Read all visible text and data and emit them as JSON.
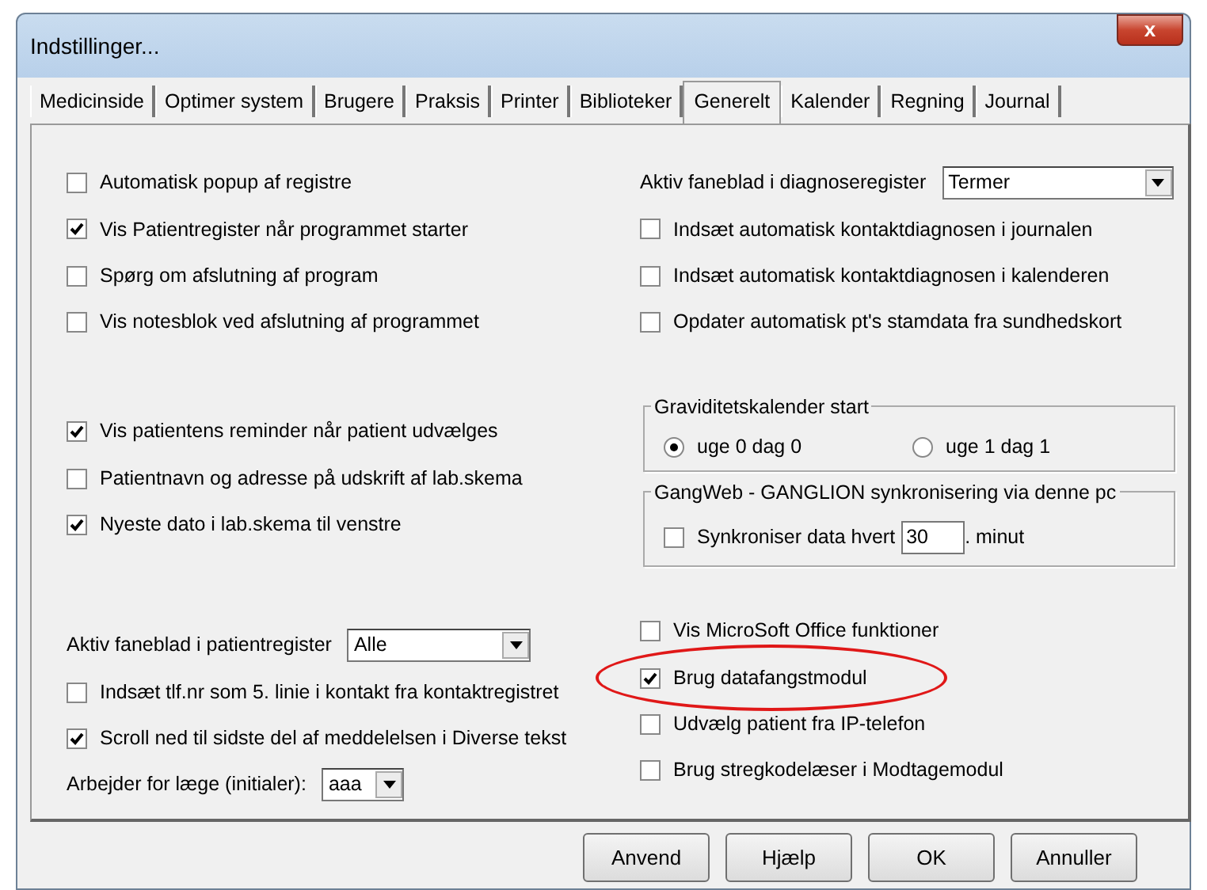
{
  "window": {
    "title": "Indstillinger...",
    "close": "x"
  },
  "tabs": [
    {
      "label": "Medicinside",
      "selected": false
    },
    {
      "label": "Optimer system",
      "selected": false
    },
    {
      "label": "Brugere",
      "selected": false
    },
    {
      "label": "Praksis",
      "selected": false
    },
    {
      "label": "Printer",
      "selected": false
    },
    {
      "label": "Biblioteker",
      "selected": false
    },
    {
      "label": "Generelt",
      "selected": true
    },
    {
      "label": "Kalender",
      "selected": false
    },
    {
      "label": "Regning",
      "selected": false
    },
    {
      "label": "Journal",
      "selected": false
    }
  ],
  "left_sections": [
    [
      {
        "kind": "checkbox",
        "label": "Automatisk popup af registre",
        "checked": false
      },
      {
        "kind": "checkbox",
        "label": "Vis Patientregister når programmet starter",
        "checked": true
      },
      {
        "kind": "checkbox",
        "label": "Spørg om afslutning af program",
        "checked": false
      },
      {
        "kind": "checkbox",
        "label": "Vis notesblok ved afslutning af programmet",
        "checked": false
      }
    ],
    [
      {
        "kind": "checkbox",
        "label": "Vis patientens reminder når patient udvælges",
        "checked": true
      },
      {
        "kind": "checkbox",
        "label": "Patientnavn og adresse på udskrift af lab.skema",
        "checked": false
      },
      {
        "kind": "checkbox",
        "label": "Nyeste dato i lab.skema til venstre",
        "checked": true
      }
    ],
    [
      {
        "kind": "select",
        "label": "Aktiv faneblad i patientregister",
        "value": "Alle"
      },
      {
        "kind": "checkbox",
        "label": "Indsæt tlf.nr som 5. linie i kontakt fra kontaktregistret",
        "checked": false
      },
      {
        "kind": "checkbox",
        "label": "Scroll ned til sidste del af meddelelsen i Diverse tekst",
        "checked": true
      },
      {
        "kind": "select",
        "label": "Arbejder for læge (initialer):",
        "value": "aaa"
      }
    ]
  ],
  "right_top": [
    {
      "kind": "select",
      "label": "Aktiv faneblad i diagnoseregister",
      "value": "Termer"
    },
    {
      "kind": "checkbox",
      "label": "Indsæt automatisk kontaktdiagnosen i journalen",
      "checked": false
    },
    {
      "kind": "checkbox",
      "label": "Indsæt automatisk kontaktdiagnosen i kalenderen",
      "checked": false
    },
    {
      "kind": "checkbox",
      "label": "Opdater automatisk pt's stamdata fra sundhedskort",
      "checked": false
    }
  ],
  "pregnancy_group": {
    "title": "Graviditetskalender start",
    "options": [
      {
        "label": "uge 0 dag 0",
        "selected": true
      },
      {
        "label": "uge 1 dag 1",
        "selected": false
      }
    ]
  },
  "sync_group": {
    "title": "GangWeb - GANGLION synkronisering via denne pc",
    "label": "Synkroniser data hvert",
    "checked": false,
    "value": "30",
    "suffix": ". minut"
  },
  "right_bottom": [
    {
      "label": "Vis MicroSoft Office funktioner",
      "checked": false,
      "highlighted": false
    },
    {
      "label": "Brug datafangstmodul",
      "checked": true,
      "highlighted": true
    },
    {
      "label": "Udvælg patient fra IP-telefon",
      "checked": false,
      "highlighted": false
    },
    {
      "label": "Brug stregkodelæser i Modtagemodul",
      "checked": false,
      "highlighted": false
    }
  ],
  "buttons": [
    "Anvend",
    "Hjælp",
    "OK",
    "Annuller"
  ]
}
